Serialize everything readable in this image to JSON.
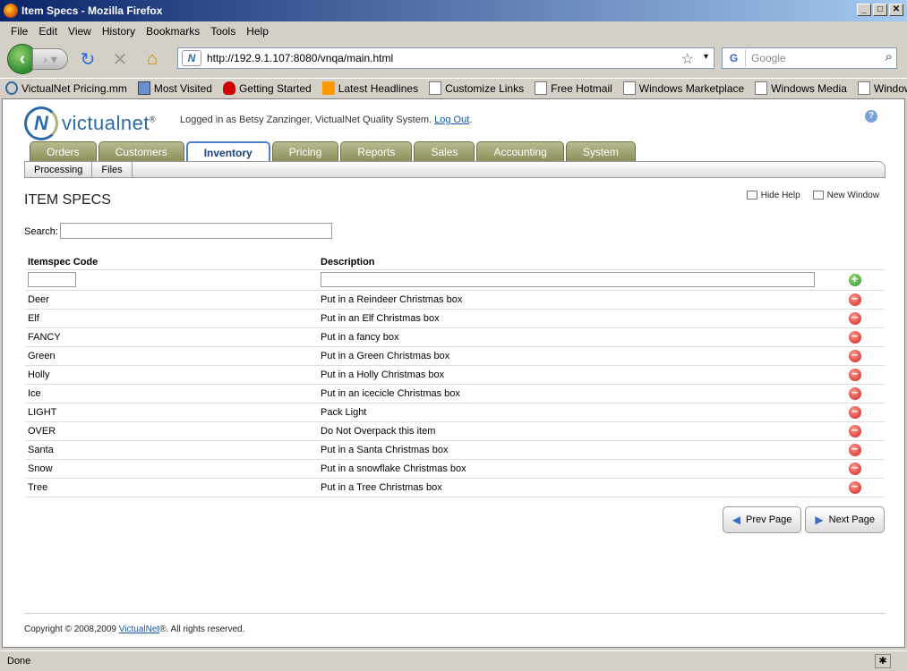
{
  "window": {
    "title": "Item Specs - Mozilla Firefox"
  },
  "menu": [
    "File",
    "Edit",
    "View",
    "History",
    "Bookmarks",
    "Tools",
    "Help"
  ],
  "browser": {
    "url": "http://192.9.1.107:8080/vnqa/main.html",
    "search_placeholder": "Google",
    "status": "Done"
  },
  "bookmarks": [
    "VictualNet Pricing.mm",
    "Most Visited",
    "Getting Started",
    "Latest Headlines",
    "Customize Links",
    "Free Hotmail",
    "Windows Marketplace",
    "Windows Media",
    "Windows"
  ],
  "app": {
    "logo_text": "victualnet",
    "logged_in_text": "Logged in as Betsy Zanzinger, VictualNet Quality System.",
    "logout": "Log Out",
    "logout_end": "."
  },
  "tabs": [
    "Orders",
    "Customers",
    "Inventory",
    "Pricing",
    "Reports",
    "Sales",
    "Accounting",
    "System"
  ],
  "active_tab": "Inventory",
  "subtabs": [
    "Processing",
    "Files"
  ],
  "page": {
    "title": "ITEM SPECS",
    "hide_help": "Hide Help",
    "new_window": "New Window",
    "search_label": "Search:"
  },
  "table": {
    "headers": {
      "code": "Itemspec Code",
      "description": "Description"
    },
    "rows": [
      {
        "code": "Deer",
        "description": "Put in a Reindeer Christmas box"
      },
      {
        "code": "Elf",
        "description": "Put in an Elf Christmas box"
      },
      {
        "code": "FANCY",
        "description": "Put in a fancy box"
      },
      {
        "code": "Green",
        "description": "Put in a Green Christmas box"
      },
      {
        "code": "Holly",
        "description": "Put in a Holly Christmas box"
      },
      {
        "code": "Ice",
        "description": "Put in an icecicle Christmas box"
      },
      {
        "code": "LIGHT",
        "description": "Pack Light"
      },
      {
        "code": "OVER",
        "description": "Do Not Overpack this item"
      },
      {
        "code": "Santa",
        "description": "Put in a Santa Christmas box"
      },
      {
        "code": "Snow",
        "description": "Put in a snowflake Christmas box"
      },
      {
        "code": "Tree",
        "description": "Put in a Tree Christmas box"
      }
    ]
  },
  "pager": {
    "prev": "Prev Page",
    "next": "Next Page"
  },
  "footer": {
    "prefix": "Copyright © 2008,2009 ",
    "link": "VictualNet",
    "suffix": "®. All rights reserved."
  }
}
